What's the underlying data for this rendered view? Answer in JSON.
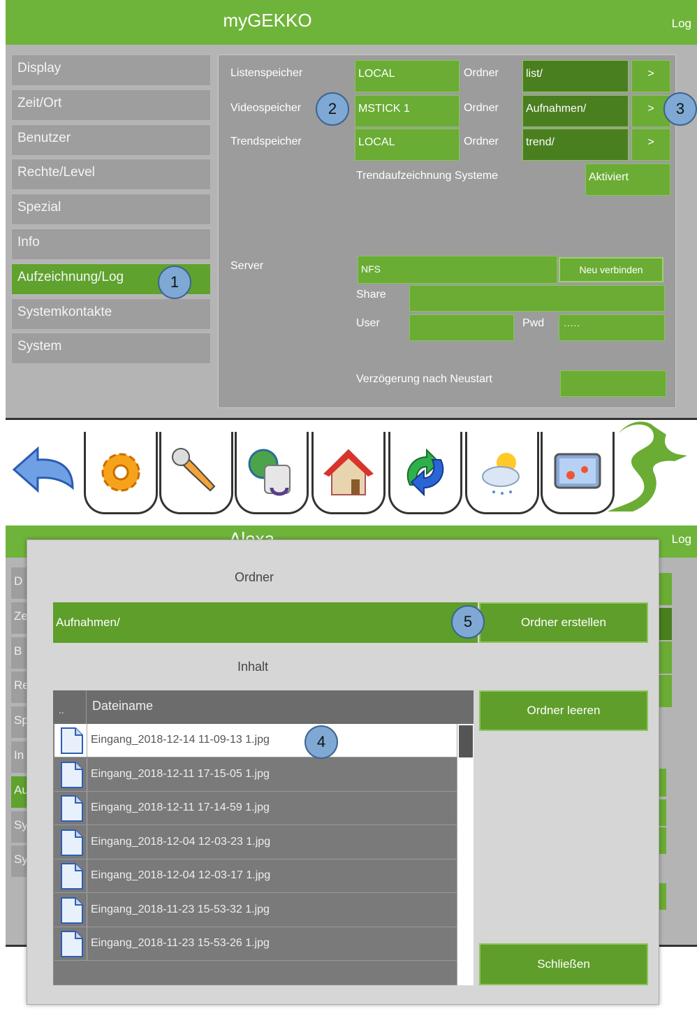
{
  "top": {
    "title": "myGEKKO",
    "log_label": "Log",
    "nav": [
      {
        "label": "Display"
      },
      {
        "label": "Zeit/Ort"
      },
      {
        "label": "Benutzer"
      },
      {
        "label": "Rechte/Level"
      },
      {
        "label": "Spezial"
      },
      {
        "label": "Info"
      },
      {
        "label": "Aufzeichnung/Log"
      },
      {
        "label": "Systemkontakte"
      },
      {
        "label": "System"
      }
    ],
    "settings": {
      "listen_label": "Listenspeicher",
      "listen_value": "LOCAL",
      "video_label": "Videospeicher",
      "video_value": "MSTICK 1",
      "trend_label": "Trendspeicher",
      "trend_value": "LOCAL",
      "ordner_label": "Ordner",
      "list_folder": "list/",
      "video_folder": "Aufnahmen/",
      "trend_folder": "trend/",
      "arrow": ">",
      "trend_system_label": "Trendaufzeichnung Systeme",
      "trend_system_value": "Aktiviert",
      "server_label": "Server",
      "server_value": "NFS",
      "reconnect_label": "Neu verbinden",
      "share_label": "Share",
      "user_label": "User",
      "pwd_label": "Pwd",
      "pwd_value": "·····",
      "delay_label": "Verzögerung nach Neustart"
    },
    "bottom_icons": [
      "back-arrow-icon",
      "gear-icon",
      "wrench-icon",
      "network-icon",
      "house-icon",
      "recycle-arrows-icon",
      "weather-icon",
      "media-player-icon",
      "gecko-logo-icon"
    ]
  },
  "callouts": [
    "1",
    "2",
    "3",
    "4",
    "5"
  ],
  "dialog": {
    "app_title": "Alexa",
    "log_label": "Log",
    "ordner_heading": "Ordner",
    "current_folder": "Aufnahmen/",
    "create_folder": "Ordner erstellen",
    "content_heading": "Inhalt",
    "col_up": "..",
    "col_filename": "Dateiname",
    "clear_folder": "Ordner leeren",
    "close": "Schließen",
    "files": [
      "Eingang_2018-12-14 11-09-13 1.jpg",
      "Eingang_2018-12-11 17-15-05 1.jpg",
      "Eingang_2018-12-11 17-14-59 1.jpg",
      "Eingang_2018-12-04 12-03-23 1.jpg",
      "Eingang_2018-12-04 12-03-17 1.jpg",
      "Eingang_2018-11-23 15-53-32 1.jpg",
      "Eingang_2018-11-23 15-53-26 1.jpg"
    ],
    "behind_nav_letters": [
      "D",
      "Ze",
      "B",
      "Re",
      "Sp",
      "In",
      "Au",
      "Sy",
      "Sy"
    ]
  }
}
